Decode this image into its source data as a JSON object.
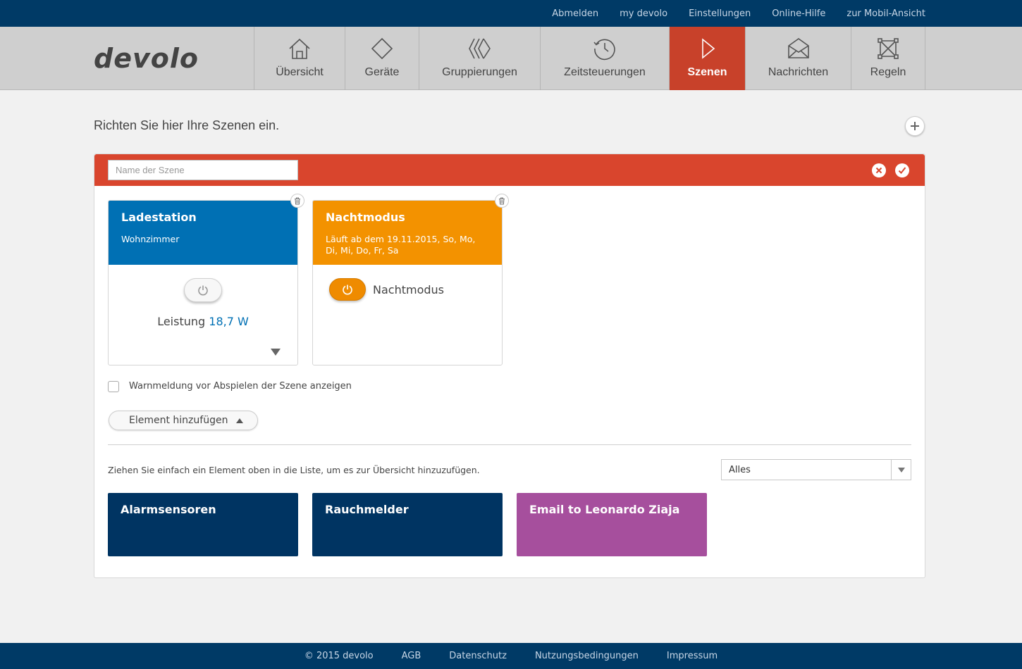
{
  "topbar": {
    "links": [
      "Abmelden",
      "my devolo",
      "Einstellungen",
      "Online-Hilfe",
      "zur Mobil-Ansicht"
    ]
  },
  "brand": {
    "logo_text": "devolo"
  },
  "nav": {
    "items": [
      {
        "label": "Übersicht",
        "icon": "house-icon"
      },
      {
        "label": "Geräte",
        "icon": "diamond-icon"
      },
      {
        "label": "Gruppierungen",
        "icon": "groups-icon"
      },
      {
        "label": "Zeitsteuerungen",
        "icon": "clock-icon"
      },
      {
        "label": "Szenen",
        "icon": "play-icon",
        "active": true
      },
      {
        "label": "Nachrichten",
        "icon": "envelope-icon"
      },
      {
        "label": "Regeln",
        "icon": "network-icon"
      }
    ]
  },
  "intro": "Richten Sie hier Ihre Szenen ein.",
  "scene": {
    "name_placeholder": "Name der Szene",
    "name_value": ""
  },
  "cards": [
    {
      "title": "Ladestation",
      "subtitle": "Wohnzimmer",
      "power_label": "Leistung",
      "power_value": "18,7 W",
      "color": "#0070b4"
    },
    {
      "title": "Nachtmodus",
      "subtitle": "Läuft ab dem 19.11.2015, So, Mo, Di, Mi, Do, Fr, Sa",
      "toggle_label": "Nachtmodus",
      "color": "#f39200"
    }
  ],
  "warning_checkbox": {
    "label": "Warnmeldung vor Abspielen der Szene anzeigen",
    "checked": false
  },
  "add_element_label": "Element hinzufügen",
  "drag_hint": "Ziehen Sie einfach ein Element oben in die Liste, um es zur Übersicht hinzuzufügen.",
  "filter": {
    "selected": "Alles"
  },
  "tiles": [
    {
      "label": "Alarmsensoren",
      "color": "#003462"
    },
    {
      "label": "Rauchmelder",
      "color": "#003462"
    },
    {
      "label": "Email to Leonardo Ziaja",
      "color": "#a64f9d"
    }
  ],
  "footer": {
    "links": [
      "© 2015 devolo",
      "AGB",
      "Datenschutz",
      "Nutzungsbedingungen",
      "Impressum"
    ]
  },
  "colors": {
    "topbar": "#003a66",
    "active_nav": "#c8412a",
    "panel_header": "#d9452d",
    "link_blue": "#0070b4"
  }
}
